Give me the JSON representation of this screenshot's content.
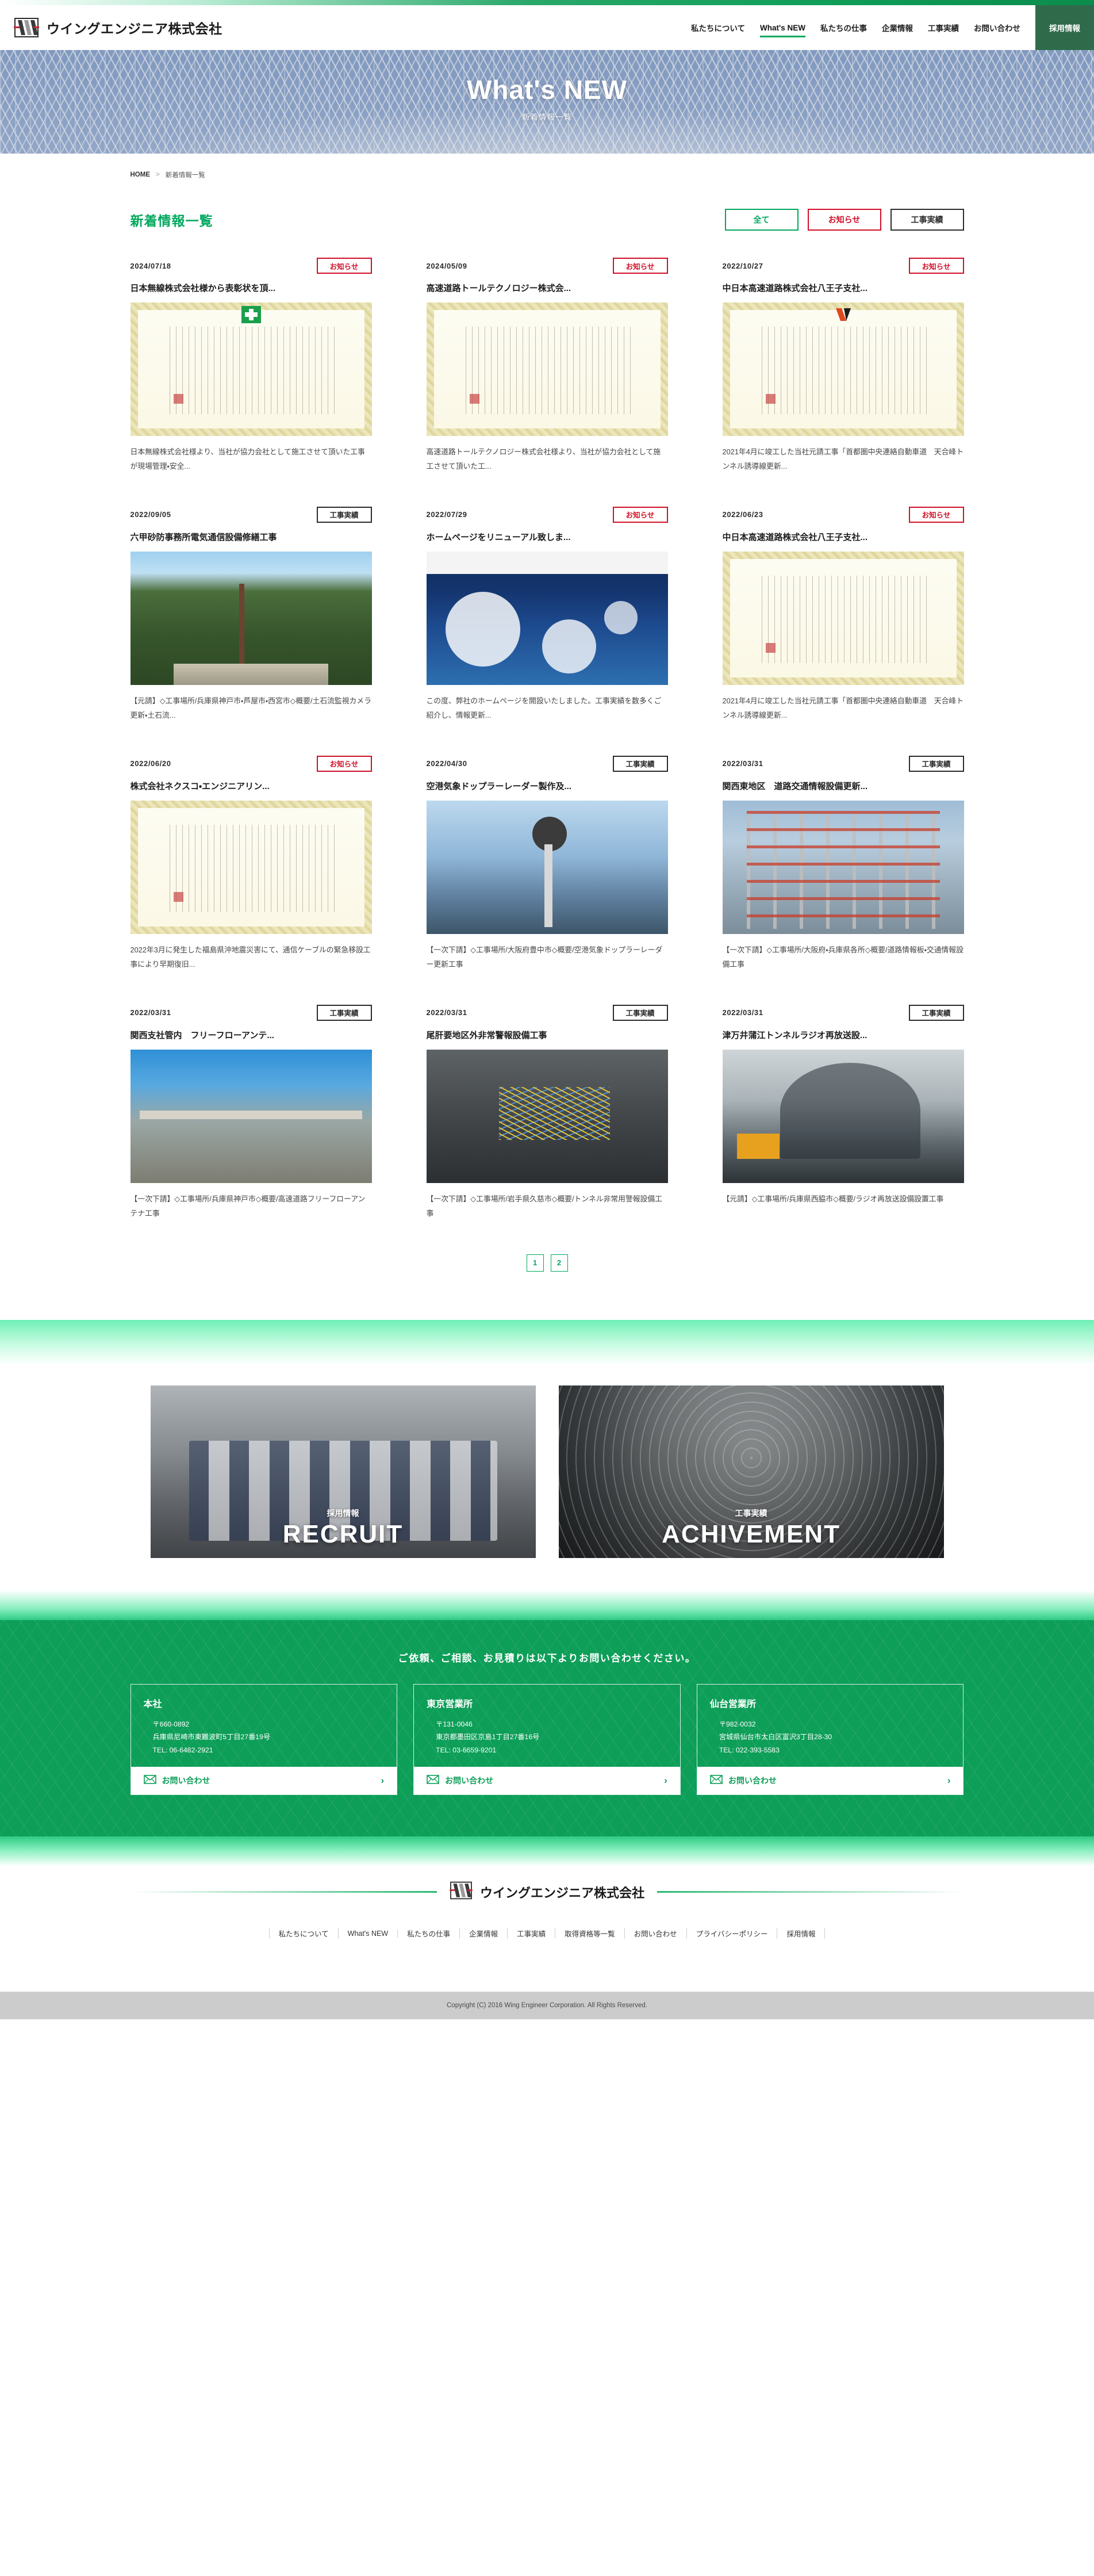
{
  "header": {
    "brand_name": "ウイングエンジニア株式会社",
    "logo_icon": "wing-w-logo",
    "nav": [
      {
        "label": "私たちについて",
        "active": false
      },
      {
        "label": "What's NEW",
        "active": true
      },
      {
        "label": "私たちの仕事",
        "active": false
      },
      {
        "label": "企業情報",
        "active": false
      },
      {
        "label": "工事実績",
        "active": false
      },
      {
        "label": "お問い合わせ",
        "active": false
      }
    ],
    "recruit_label": "採用情報",
    "accent_color": "#00a85d",
    "recruit_bg": "#2f6b4b"
  },
  "hero": {
    "title": "What's NEW",
    "subtitle": "新着情報一覧"
  },
  "breadcrumb": {
    "home": "HOME",
    "separator": ">",
    "current": "新着情報一覧"
  },
  "section": {
    "title": "新着情報一覧",
    "filters": [
      {
        "label": "全て",
        "color": "#00a85d"
      },
      {
        "label": "お知らせ",
        "color": "#d10f26"
      },
      {
        "label": "工事実績",
        "color": "#2b2b2b"
      }
    ]
  },
  "news": [
    {
      "date": "2024/07/18",
      "tag": "お知らせ",
      "tag_type": "news",
      "title": "日本無線株式会社様から表彰状を頂...",
      "desc": "日本無線株式会社様より、当社が協力会社として施工させて頂いた工事が現場管理・安全...",
      "thumb": "certificate-green-cross"
    },
    {
      "date": "2024/05/09",
      "tag": "お知らせ",
      "tag_type": "news",
      "title": "高速道路トールテクノロジー株式会...",
      "desc": "高速道路トールテクノロジー株式会社様より、当社が協力会社として施工させて頂いた工...",
      "thumb": "certificate-plain"
    },
    {
      "date": "2022/10/27",
      "tag": "お知らせ",
      "tag_type": "news",
      "title": "中日本高速道路株式会社八王子支社...",
      "desc": "2021年4月に竣工した当社元請工事「首都圏中央連絡自動車道　天合峰トンネル誘導線更新...",
      "thumb": "certificate-nexco"
    },
    {
      "date": "2022/09/05",
      "tag": "工事実績",
      "tag_type": "works",
      "title": "六甲砂防事務所電気通信設備修繕工事",
      "desc": "【元請】◇工事場所/兵庫県神戸市・芦屋市・西宮市◇概要/土石流監視カメラ更新・土石流...",
      "thumb": "forest-tower"
    },
    {
      "date": "2022/07/29",
      "tag": "お知らせ",
      "tag_type": "news",
      "title": "ホームページをリニューアル致しま...",
      "desc": "この度、弊社のホームページを開設いたしました。工事実績を数多くご紹介し、情報更新...",
      "thumb": "website-antenna"
    },
    {
      "date": "2022/06/23",
      "tag": "お知らせ",
      "tag_type": "news",
      "title": "中日本高速道路株式会社八王子支社...",
      "desc": "2021年4月に竣工した当社元請工事「首都圏中央連絡自動車道　天合峰トンネル誘導線更新...",
      "thumb": "certificate-plain"
    },
    {
      "date": "2022/06/20",
      "tag": "お知らせ",
      "tag_type": "news",
      "title": "株式会社ネクスコ・エンジニアリン...",
      "desc": "2022年3月に発生した福島県沖地震災害にて、通信ケーブルの緊急移設工事により早期復旧...",
      "thumb": "certificate-plain"
    },
    {
      "date": "2022/04/30",
      "tag": "工事実績",
      "tag_type": "works",
      "title": "空港気象ドップラーレーダー製作及...",
      "desc": "【一次下請】◇工事場所/大阪府豊中市◇概要/空港気象ドップラーレーダー更新工事",
      "thumb": "radar-tower"
    },
    {
      "date": "2022/03/31",
      "tag": "工事実績",
      "tag_type": "works",
      "title": "関西東地区　道路交通情報設備更新...",
      "desc": "【一次下請】◇工事場所/大阪府・兵庫県各所◇概要/道路情報板・交通情報設備工事",
      "thumb": "scaffold-signboard"
    },
    {
      "date": "2022/03/31",
      "tag": "工事実績",
      "tag_type": "works",
      "title": "関西支社管内　フリーフローアンテ...",
      "desc": "【一次下請】◇工事場所/兵庫県神戸市◇概要/高速道路フリーフローアンテナ工事",
      "thumb": "highway-antenna"
    },
    {
      "date": "2022/03/31",
      "tag": "工事実績",
      "tag_type": "works",
      "title": "尾肝要地区外非常警報設備工事",
      "desc": "【一次下請】◇工事場所/岩手県久慈市◇概要/トンネル非常用警報設備工事",
      "thumb": "cable-splice"
    },
    {
      "date": "2022/03/31",
      "tag": "工事実績",
      "tag_type": "works",
      "title": "津万井蒲江トンネルラジオ再放送設...",
      "desc": "【元請】◇工事場所/兵庫県西脇市◇概要/ラジオ再放送設備設置工事",
      "thumb": "tunnel-interior"
    }
  ],
  "pagination": {
    "pages": [
      "1",
      "2"
    ],
    "current": "1"
  },
  "banners": [
    {
      "kicker": "採用情報",
      "title": "RECRUIT",
      "image": "staff-group-photo"
    },
    {
      "kicker": "工事実績",
      "title": "ACHIVEMENT",
      "image": "antenna-dish-interior"
    }
  ],
  "contact": {
    "heading": "ご依頼、ご相談、お見積りは以下よりお問い合わせください。",
    "cta_label": "お問い合わせ",
    "cta_icon": "mail-icon",
    "cta_arrow": "›",
    "offices": [
      {
        "name": "本社",
        "postal": "〒660-0892",
        "address": "兵庫県尼崎市東難波町5丁目27番19号",
        "tel": "TEL: 06-6482-2921"
      },
      {
        "name": "東京営業所",
        "postal": "〒131-0046",
        "address": "東京都墨田区京島1丁目27番16号",
        "tel": "TEL: 03-6659-9201"
      },
      {
        "name": "仙台営業所",
        "postal": "〒982-0032",
        "address": "宮城県仙台市太白区富沢3丁目28-30",
        "tel": "TEL: 022-393-5583"
      }
    ]
  },
  "footer": {
    "brand_name": "ウイングエンジニア株式会社",
    "logo_icon": "wing-w-logo",
    "nav": [
      "私たちについて",
      "What's NEW",
      "私たちの仕事",
      "企業情報",
      "工事実績",
      "取得資格等一覧",
      "お問い合わせ",
      "プライバシーポリシー",
      "採用情報"
    ],
    "copyright": "Copyright (C) 2016 Wing Engineer Corporation. All Rights Reserved."
  }
}
